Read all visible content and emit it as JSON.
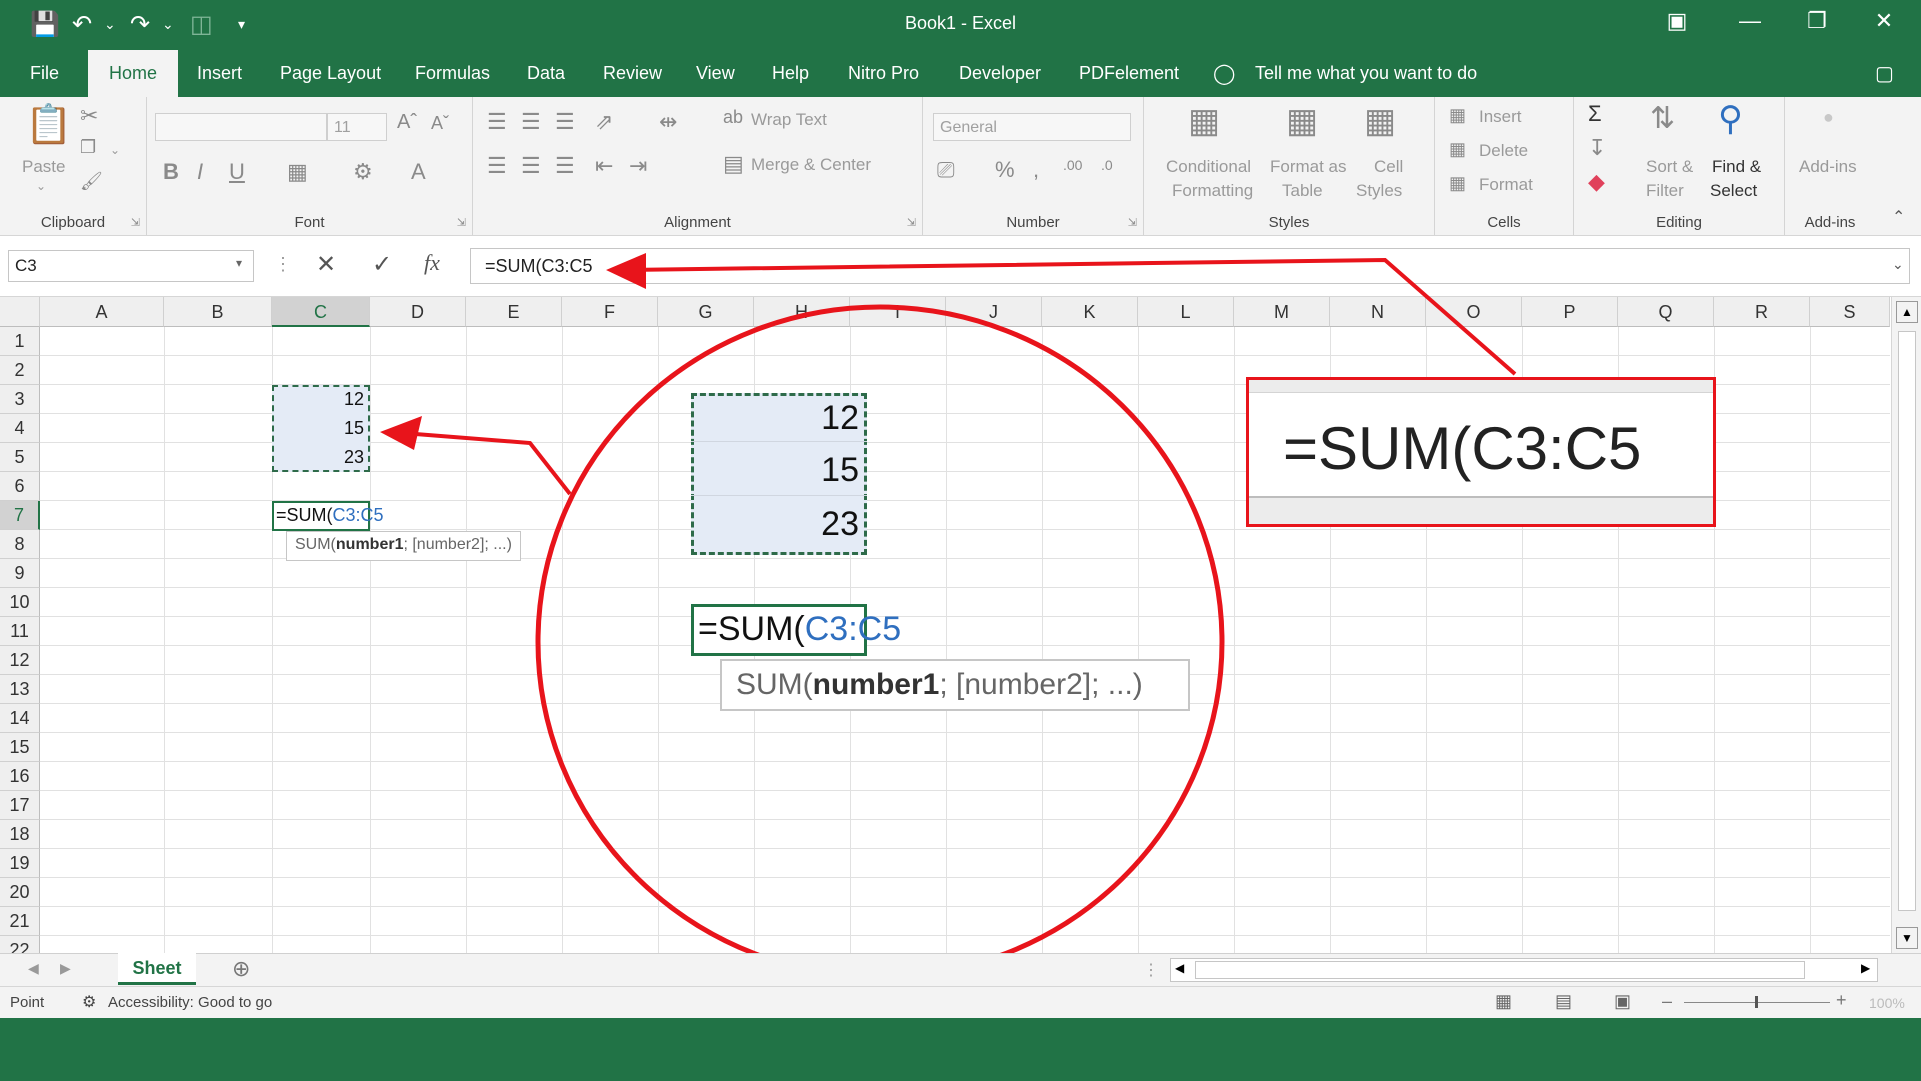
{
  "window": {
    "title": "Book1  -  Excel"
  },
  "tabs": [
    "File",
    "Home",
    "Insert",
    "Page Layout",
    "Formulas",
    "Data",
    "Review",
    "View",
    "Help",
    "Nitro Pro",
    "Developer",
    "PDFelement"
  ],
  "tell_me": "Tell me what you want to do",
  "ribbon": {
    "clipboard": {
      "label": "Clipboard",
      "paste": "Paste"
    },
    "font": {
      "label": "Font",
      "font_size": "11"
    },
    "alignment": {
      "label": "Alignment",
      "wrap_text": "Wrap Text",
      "merge_center": "Merge & Center"
    },
    "number": {
      "label": "Number",
      "format": "General"
    },
    "styles": {
      "label": "Styles",
      "cond_1": "Conditional",
      "cond_2": "Formatting",
      "fmt_table_1": "Format as",
      "fmt_table_2": "Table",
      "cell_styles_1": "Cell",
      "cell_styles_2": "Styles"
    },
    "cells": {
      "label": "Cells",
      "insert": "Insert",
      "delete": "Delete",
      "format": "Format"
    },
    "editing": {
      "label": "Editing",
      "sort_1": "Sort &",
      "sort_2": "Filter",
      "find_1": "Find &",
      "find_2": "Select"
    },
    "addins": {
      "label": "Add-ins",
      "button": "Add-ins"
    }
  },
  "formula_bar": {
    "name_box": "C3",
    "formula": "=SUM(C3:C5",
    "fx": "fx"
  },
  "columns": [
    "A",
    "B",
    "C",
    "D",
    "E",
    "F",
    "G",
    "H",
    "I",
    "J",
    "K",
    "L",
    "M",
    "N",
    "O",
    "P",
    "Q",
    "R",
    "S"
  ],
  "rows": [
    "1",
    "2",
    "3",
    "4",
    "5",
    "6",
    "7",
    "8",
    "9",
    "10",
    "11",
    "12",
    "13",
    "14",
    "15",
    "16",
    "17",
    "18",
    "19",
    "20",
    "21",
    "22"
  ],
  "cells": {
    "c3": "12",
    "c4": "15",
    "c5": "23",
    "c7_prefix": "=SUM(",
    "c7_ref": "C3:C5"
  },
  "tooltip": {
    "prefix": "SUM(",
    "arg1": "number1",
    "rest": "; [number2]; ...)"
  },
  "zoom_circle": {
    "v1": "12",
    "v2": "15",
    "v3": "23",
    "formula_prefix": "=SUM(",
    "formula_ref": "C3:C5",
    "tip_prefix": "SUM(",
    "tip_arg1": "number1",
    "tip_rest": "; [number2]; ...)"
  },
  "callout": {
    "text": "=SUM(C3:C5"
  },
  "sheet_tab": "Sheet",
  "status": {
    "mode": "Point",
    "accessibility": "Accessibility: Good to go",
    "zoom": "100%"
  },
  "colors": {
    "excel_green": "#217346",
    "annotation_red": "#e8141b",
    "ref_blue": "#2f6fbf"
  }
}
